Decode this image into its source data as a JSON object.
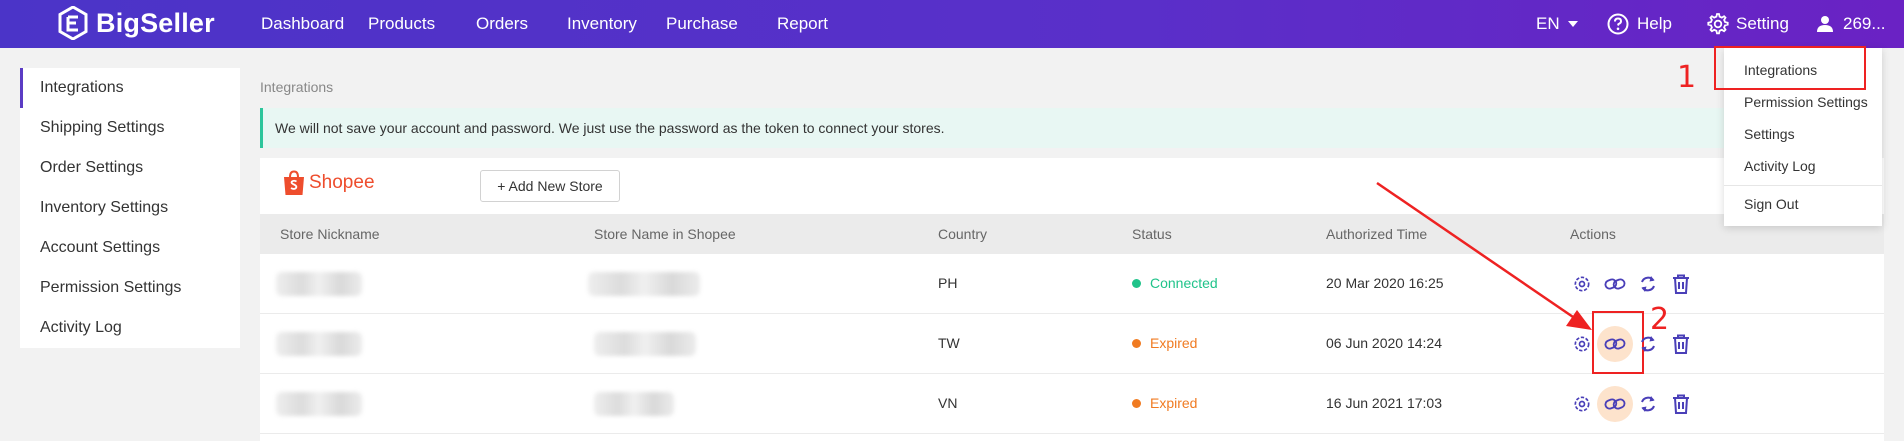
{
  "topbar": {
    "logo_text": "BigSeller",
    "nav": [
      "Dashboard",
      "Products",
      "Orders",
      "Inventory",
      "Purchase",
      "Report"
    ],
    "language": "EN",
    "help": "Help",
    "setting": "Setting",
    "user": "269..."
  },
  "sidebar": {
    "items": [
      "Integrations",
      "Shipping Settings",
      "Order Settings",
      "Inventory Settings",
      "Account Settings",
      "Permission Settings",
      "Activity Log"
    ]
  },
  "breadcrumb": "Integrations",
  "notice": "We will not save your account and password. We just use the password as the token to connect your stores.",
  "platform": {
    "name": "Shopee",
    "add_button": "+ Add New Store"
  },
  "table": {
    "headers": [
      "Store Nickname",
      "Store Name in Shopee",
      "Country",
      "Status",
      "Authorized Time",
      "Actions"
    ],
    "rows": [
      {
        "country": "PH",
        "status": "Connected",
        "time": "20 Mar 2020 16:25"
      },
      {
        "country": "TW",
        "status": "Expired",
        "time": "06 Jun 2020 14:24"
      },
      {
        "country": "VN",
        "status": "Expired",
        "time": "16 Jun 2021 17:03"
      }
    ]
  },
  "dropdown": {
    "items": [
      "Integrations",
      "Permission Settings",
      "Settings",
      "Activity Log",
      "Sign Out"
    ]
  },
  "annotations": {
    "step1": "1",
    "step2": "2"
  },
  "colors": {
    "brand_purple": "#5b3cc4",
    "shopee_orange": "#ee4d2d",
    "connected_green": "#20c38a",
    "expired_orange": "#f07b22",
    "annotation_red": "#ee2222"
  },
  "icons": [
    "settings-icon",
    "link-icon",
    "refresh-icon",
    "delete-icon"
  ]
}
